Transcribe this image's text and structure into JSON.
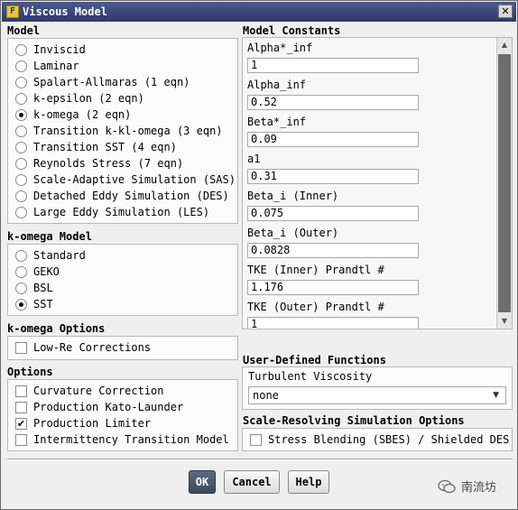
{
  "window": {
    "title": "Viscous Model",
    "app_icon": "F",
    "close": "✕"
  },
  "model": {
    "title": "Model",
    "options": [
      {
        "label": "Inviscid",
        "selected": false
      },
      {
        "label": "Laminar",
        "selected": false
      },
      {
        "label": "Spalart-Allmaras (1 eqn)",
        "selected": false
      },
      {
        "label": "k-epsilon (2 eqn)",
        "selected": false
      },
      {
        "label": "k-omega (2 eqn)",
        "selected": true
      },
      {
        "label": "Transition k-kl-omega (3 eqn)",
        "selected": false
      },
      {
        "label": "Transition SST (4 eqn)",
        "selected": false
      },
      {
        "label": "Reynolds Stress (7 eqn)",
        "selected": false
      },
      {
        "label": "Scale-Adaptive Simulation (SAS)",
        "selected": false
      },
      {
        "label": "Detached Eddy Simulation (DES)",
        "selected": false
      },
      {
        "label": "Large Eddy Simulation (LES)",
        "selected": false
      }
    ]
  },
  "komega_model": {
    "title": "k-omega Model",
    "options": [
      {
        "label": "Standard",
        "selected": false
      },
      {
        "label": "GEKO",
        "selected": false
      },
      {
        "label": "BSL",
        "selected": false
      },
      {
        "label": "SST",
        "selected": true
      }
    ]
  },
  "komega_options": {
    "title": "k-omega Options",
    "items": [
      {
        "label": "Low-Re Corrections",
        "checked": false
      }
    ]
  },
  "options": {
    "title": "Options",
    "items": [
      {
        "label": "Curvature Correction",
        "checked": false
      },
      {
        "label": "Production Kato-Launder",
        "checked": false
      },
      {
        "label": "Production Limiter",
        "checked": true
      },
      {
        "label": "Intermittency Transition Model",
        "checked": false
      }
    ]
  },
  "constants": {
    "title": "Model Constants",
    "params": [
      {
        "label": "Alpha*_inf",
        "value": "1"
      },
      {
        "label": "Alpha_inf",
        "value": "0.52"
      },
      {
        "label": "Beta*_inf",
        "value": "0.09"
      },
      {
        "label": "a1",
        "value": "0.31"
      },
      {
        "label": "Beta_i (Inner)",
        "value": "0.075"
      },
      {
        "label": "Beta_i (Outer)",
        "value": "0.0828"
      },
      {
        "label": "TKE (Inner) Prandtl #",
        "value": "1.176"
      },
      {
        "label": "TKE (Outer) Prandtl #",
        "value": "1"
      }
    ]
  },
  "udf": {
    "title": "User-Defined Functions",
    "field_label": "Turbulent Viscosity",
    "value": "none"
  },
  "sro": {
    "title": "Scale-Resolving Simulation Options",
    "items": [
      {
        "label": "Stress Blending (SBES) / Shielded DES",
        "checked": false
      }
    ]
  },
  "buttons": {
    "ok": "OK",
    "cancel": "Cancel",
    "help": "Help"
  },
  "watermark": {
    "text": "南流坊"
  }
}
